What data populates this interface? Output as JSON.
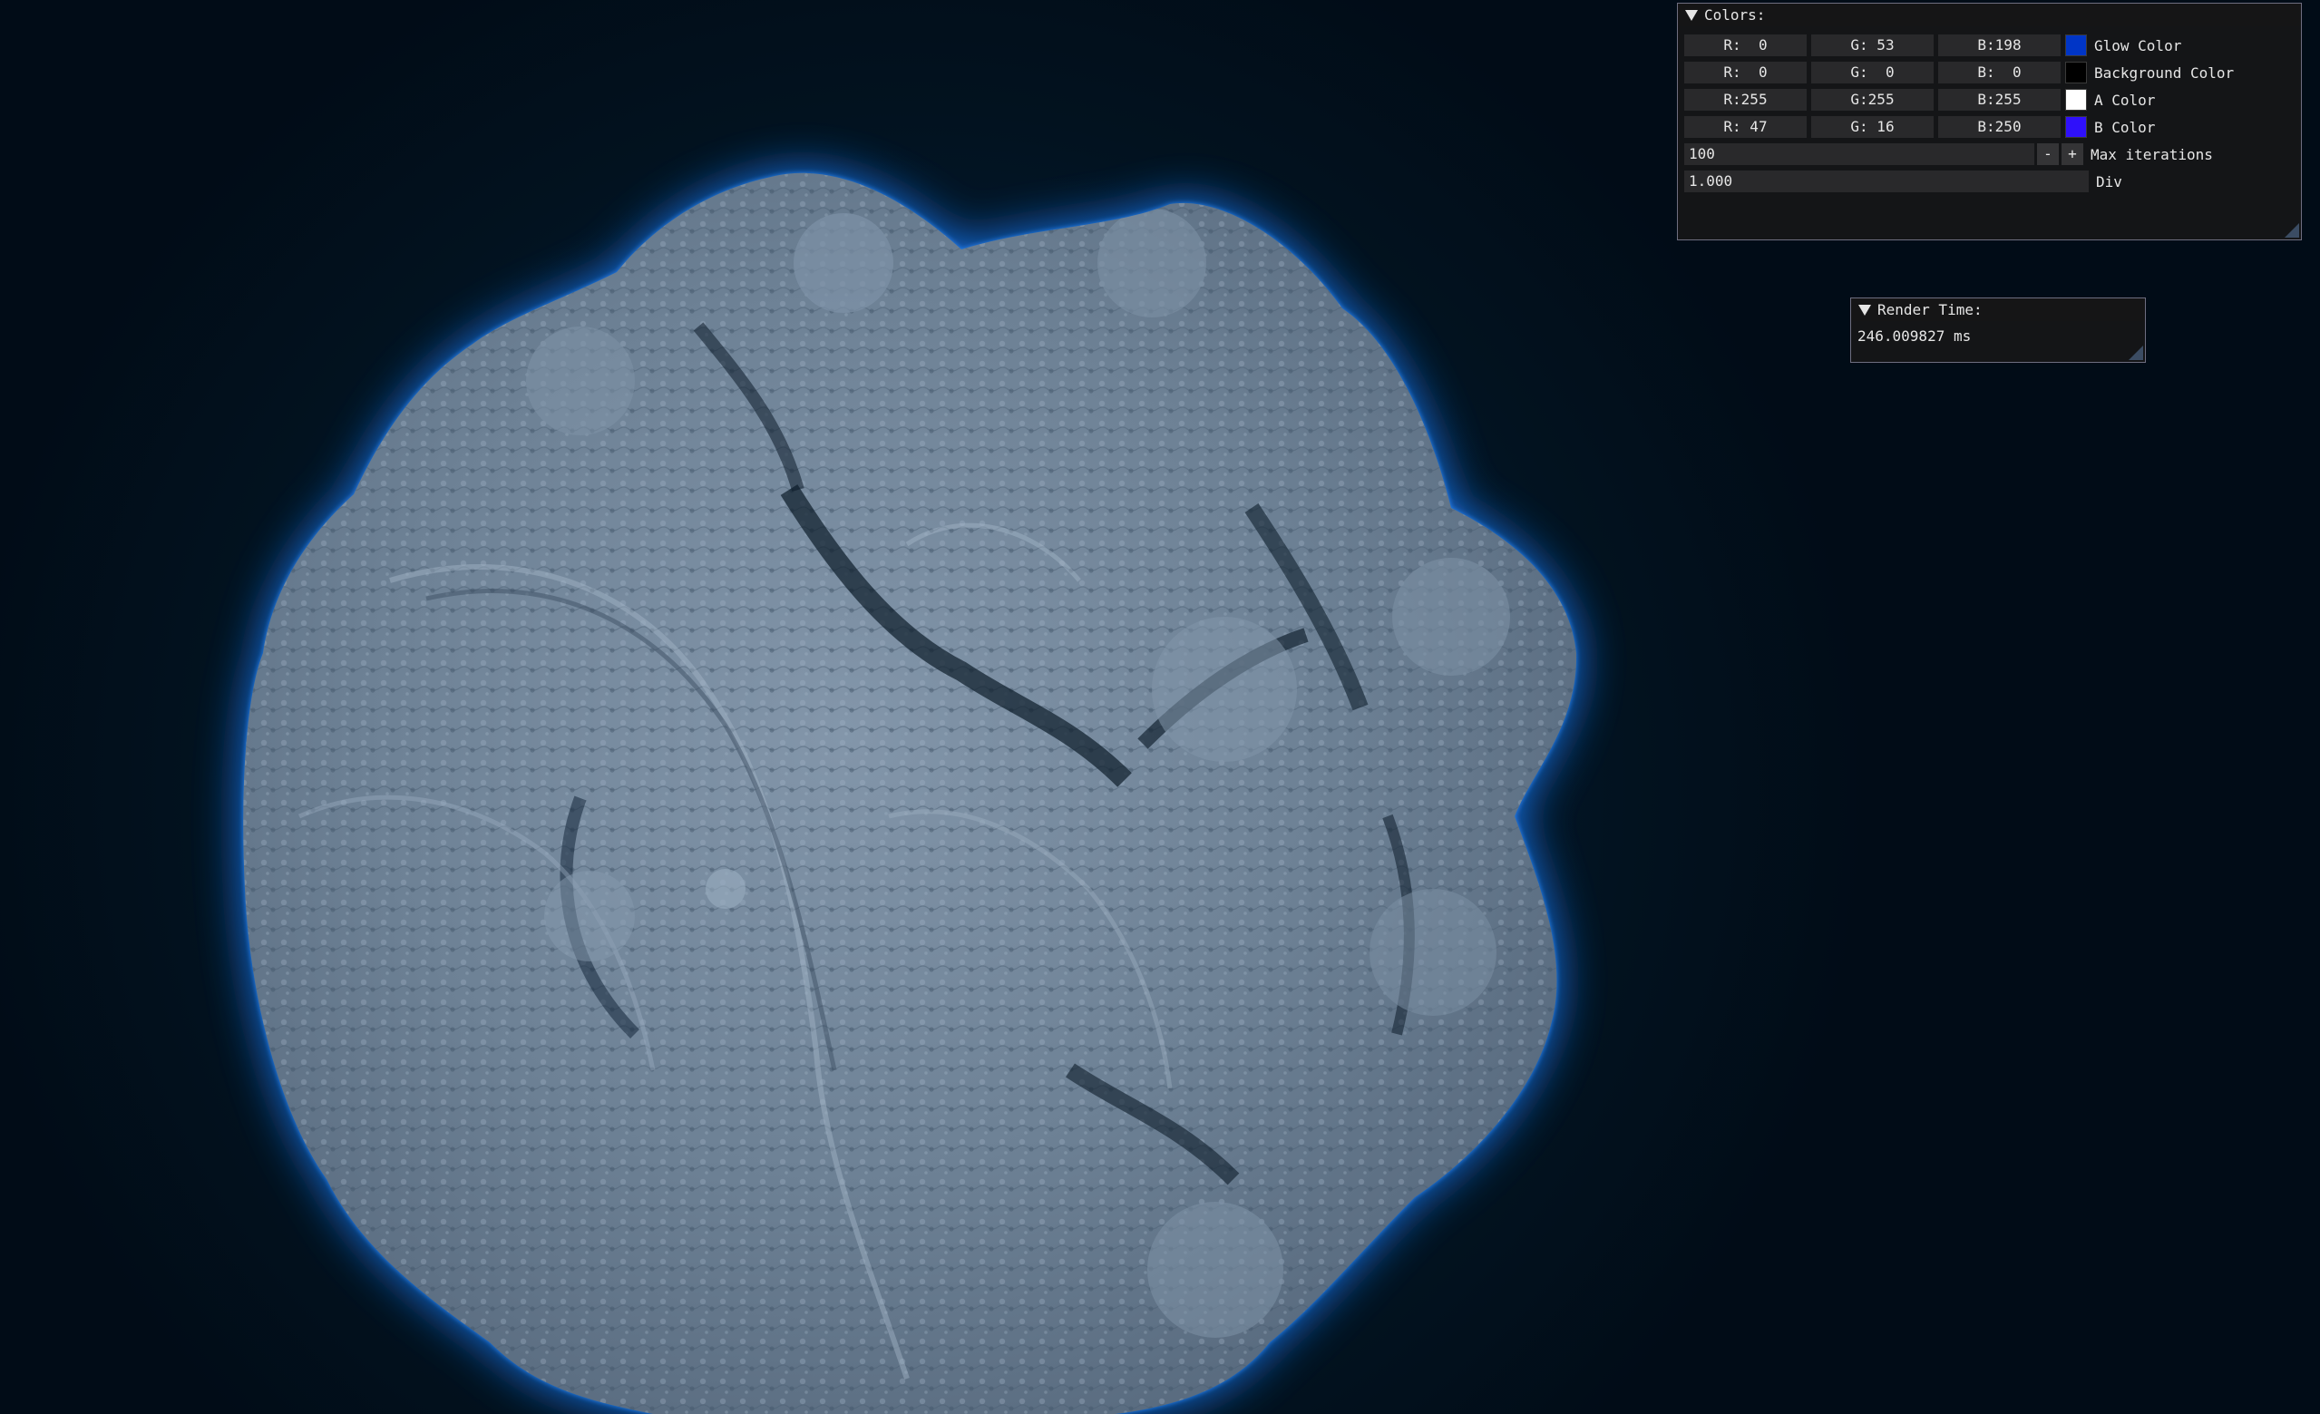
{
  "colors_panel": {
    "title": "Colors:",
    "rows": [
      {
        "r": "R:  0",
        "g": "G: 53",
        "b": "B:198",
        "swatch": "#0035c6",
        "label": "Glow Color"
      },
      {
        "r": "R:  0",
        "g": "G:  0",
        "b": "B:  0",
        "swatch": "#000000",
        "label": "Background Color"
      },
      {
        "r": "R:255",
        "g": "G:255",
        "b": "B:255",
        "swatch": "#ffffff",
        "label": "A Color"
      },
      {
        "r": "R: 47",
        "g": "G: 16",
        "b": "B:250",
        "swatch": "#2f10fa",
        "label": "B Color"
      }
    ],
    "max_iterations": {
      "value": "100",
      "minus": "-",
      "plus": "+",
      "label": "Max iterations"
    },
    "div": {
      "value": "1.000",
      "label": "Div"
    }
  },
  "render_panel": {
    "title": "Render Time:",
    "value": "246.009827 ms"
  },
  "theme": {
    "glow": "#1a82ff",
    "fractal_surface": "#6f8296",
    "fractal_shadow": "#0b1a26",
    "panel_bg": "#151617",
    "field_bg": "#29292b"
  }
}
